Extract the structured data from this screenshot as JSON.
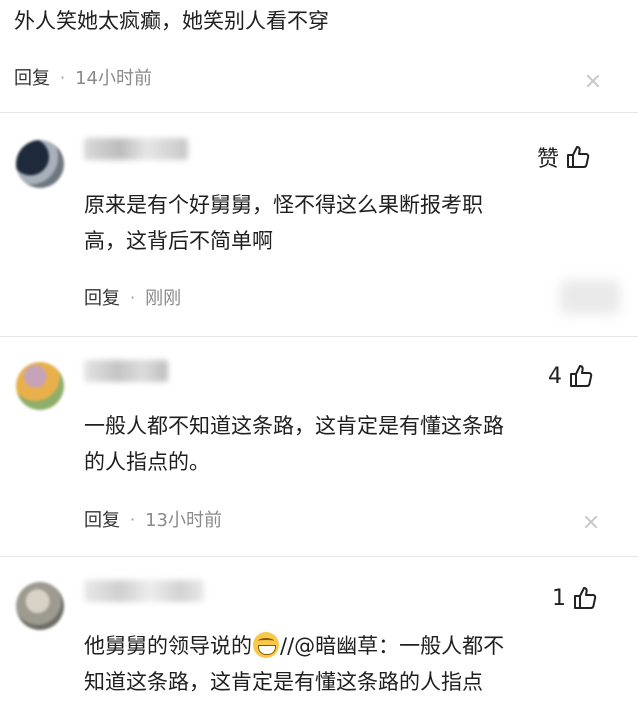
{
  "top_comment": {
    "text": "外人笑她太疯癫，她笑别人看不穿",
    "reply_label": "回复",
    "time": "14小时前"
  },
  "comments": [
    {
      "like_label": "赞",
      "body": "原来是有个好舅舅，怪不得这么果断报考职高，这背后不简单啊",
      "body_line1": "原来是有个好舅舅，怪不得这么果断报考职",
      "body_line2": "高，这背后不简单啊",
      "reply_label": "回复",
      "time": "刚刚"
    },
    {
      "like_count": "4",
      "body_line1": "一般人都不知道这条路，这肯定是有懂这条路",
      "body_line2": "的人指点的。",
      "reply_label": "回复",
      "time": "13小时前"
    },
    {
      "like_count": "1",
      "body_line1_a": "他舅舅的领导说的",
      "body_line1_b": "//",
      "mention": "@暗幽草",
      "body_line1_c": "：一般人都不",
      "body_line2": "知道这条路，这肯定是有懂这条路的人指点"
    }
  ],
  "icons": {
    "like": "thumbs-up-icon",
    "close": "close-icon",
    "emoji": "grin-emoji-icon"
  },
  "colors": {
    "text": "#1f1f1f",
    "time": "#8a8a8a",
    "divider": "#e6e6e6"
  }
}
